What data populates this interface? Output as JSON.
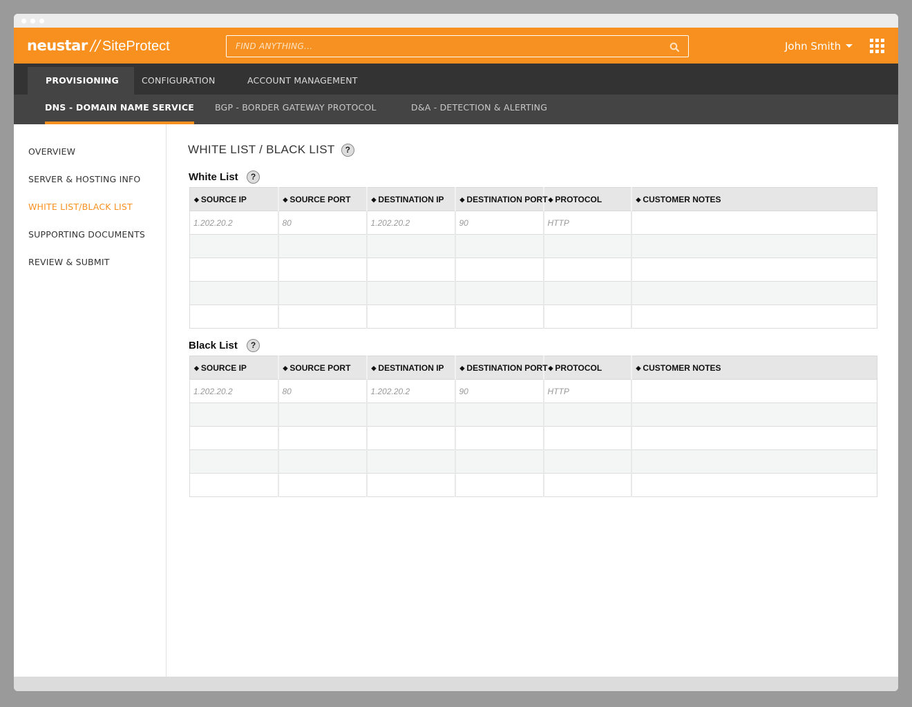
{
  "app": {
    "brand": "neustar",
    "separator": "//",
    "product": "SiteProtect",
    "colors": {
      "accent": "#f7901e",
      "nav_dark": "#333333",
      "nav_secondary": "#444444"
    }
  },
  "search": {
    "placeholder": "FIND ANYTHING...",
    "icon": "search-icon"
  },
  "user": {
    "name": "John Smith",
    "menu_icon": "caret-down-icon",
    "apps_icon": "grid-apps-icon"
  },
  "nav_primary": [
    {
      "label": "PROVISIONING",
      "active": true
    },
    {
      "label": "CONFIGURATION",
      "active": false
    },
    {
      "label": "ACCOUNT MANAGEMENT",
      "active": false
    }
  ],
  "nav_secondary": [
    {
      "label": "DNS - DOMAIN NAME SERVICE",
      "active": true
    },
    {
      "label": "BGP - BORDER GATEWAY PROTOCOL",
      "active": false
    },
    {
      "label": "D&A - DETECTION & ALERTING",
      "active": false
    }
  ],
  "sidebar": {
    "items": [
      {
        "label": "OVERVIEW",
        "active": false
      },
      {
        "label": "SERVER & HOSTING INFO",
        "active": false
      },
      {
        "label": "WHITE LIST/BLACK LIST",
        "active": true
      },
      {
        "label": "SUPPORTING DOCUMENTS",
        "active": false
      },
      {
        "label": "REVIEW & SUBMIT",
        "active": false
      }
    ]
  },
  "page": {
    "title": "WHITE LIST / BLACK LIST",
    "help": "?"
  },
  "white_list": {
    "title": "White List",
    "help": "?",
    "columns": [
      "SOURCE IP",
      "SOURCE PORT",
      "DESTINATION IP",
      "DESTINATION PORT",
      "PROTOCOL",
      "CUSTOMER NOTES"
    ],
    "rows": [
      [
        "1.202.20.2",
        "80",
        "1.202.20.2",
        "90",
        "HTTP",
        ""
      ],
      [
        "",
        "",
        "",
        "",
        "",
        ""
      ],
      [
        "",
        "",
        "",
        "",
        "",
        ""
      ],
      [
        "",
        "",
        "",
        "",
        "",
        ""
      ],
      [
        "",
        "",
        "",
        "",
        "",
        ""
      ]
    ]
  },
  "black_list": {
    "title": "Black List",
    "help": "?",
    "columns": [
      "SOURCE IP",
      "SOURCE PORT",
      "DESTINATION IP",
      "DESTINATION PORT",
      "PROTOCOL",
      "CUSTOMER NOTES"
    ],
    "rows": [
      [
        "1.202.20.2",
        "80",
        "1.202.20.2",
        "90",
        "HTTP",
        ""
      ],
      [
        "",
        "",
        "",
        "",
        "",
        ""
      ],
      [
        "",
        "",
        "",
        "",
        "",
        ""
      ],
      [
        "",
        "",
        "",
        "",
        "",
        ""
      ],
      [
        "",
        "",
        "",
        "",
        "",
        ""
      ]
    ]
  },
  "sort_glyph": "◆"
}
